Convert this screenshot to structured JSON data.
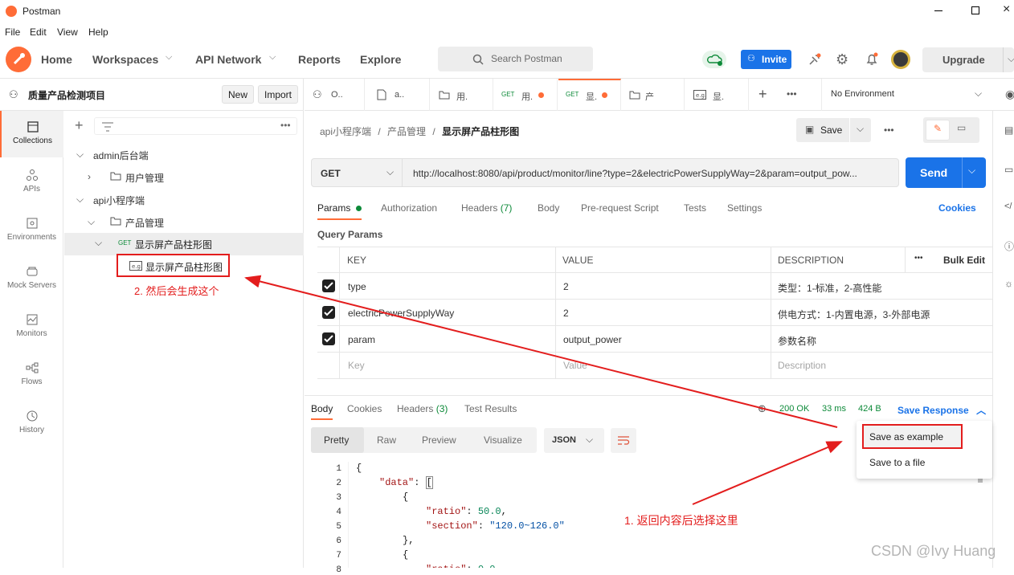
{
  "window": {
    "title": "Postman"
  },
  "menu": [
    "File",
    "Edit",
    "View",
    "Help"
  ],
  "header": {
    "nav": [
      "Home",
      "Workspaces",
      "API Network",
      "Reports",
      "Explore"
    ],
    "search_placeholder": "Search Postman",
    "invite": "Invite",
    "upgrade": "Upgrade"
  },
  "workspace": {
    "name": "质量产品检测项目",
    "new": "New",
    "import": "Import"
  },
  "rail": [
    "Collections",
    "APIs",
    "Environments",
    "Mock Servers",
    "Monitors",
    "Flows",
    "History"
  ],
  "tree": {
    "admin": "admin后台端",
    "user_mgmt": "用户管理",
    "api": "api小程序端",
    "product_mgmt": "产品管理",
    "req_method": "GET",
    "req_name": "显示屏产品柱形图",
    "example_name": "显示屏产品柱形图"
  },
  "annotations": {
    "note1": "1. 返回内容后选择这里",
    "note2": "2. 然后会生成这个",
    "watermark": "CSDN @Ivy Huang"
  },
  "tabs": [
    {
      "label": "O.."
    },
    {
      "label": "a.."
    },
    {
      "label": "用."
    },
    {
      "method": "GET",
      "label": "用."
    },
    {
      "method": "GET",
      "label": "显."
    },
    {
      "label": "产"
    },
    {
      "label": "显."
    }
  ],
  "environment": "No Environment",
  "breadcrumb": [
    "api小程序端",
    "产品管理",
    "显示屏产品柱形图"
  ],
  "request": {
    "save": "Save",
    "method": "GET",
    "url": "http://localhost:8080/api/product/monitor/line?type=2&electricPowerSupplyWay=2&param=output_pow...",
    "send": "Send"
  },
  "req_tabs": {
    "params": "Params",
    "auth": "Authorization",
    "headers": "Headers",
    "headers_count": "(7)",
    "body": "Body",
    "prereq": "Pre-request Script",
    "tests": "Tests",
    "settings": "Settings",
    "cookies": "Cookies"
  },
  "query": {
    "title": "Query Params",
    "columns": {
      "key": "KEY",
      "value": "VALUE",
      "description": "DESCRIPTION",
      "bulk": "Bulk Edit"
    },
    "rows": [
      {
        "key": "type",
        "value": "2",
        "description": "类型：1-标准，2-高性能"
      },
      {
        "key": "electricPowerSupplyWay",
        "value": "2",
        "description": "供电方式：1-内置电源，3-外部电源"
      },
      {
        "key": "param",
        "value": "output_power",
        "description": "参数名称"
      }
    ],
    "placeholders": {
      "key": "Key",
      "value": "Value",
      "description": "Description"
    }
  },
  "response": {
    "tabs": {
      "body": "Body",
      "cookies": "Cookies",
      "headers": "Headers",
      "headers_count": "(3)",
      "tests": "Test Results"
    },
    "status": "200 OK",
    "time": "33 ms",
    "size": "424 B",
    "save_response": "Save Response",
    "views": [
      "Pretty",
      "Raw",
      "Preview",
      "Visualize"
    ],
    "format": "JSON",
    "menu": [
      "Save as example",
      "Save to a file"
    ],
    "lines": [
      "1",
      "2",
      "3",
      "4",
      "5",
      "6",
      "7",
      "8"
    ]
  }
}
